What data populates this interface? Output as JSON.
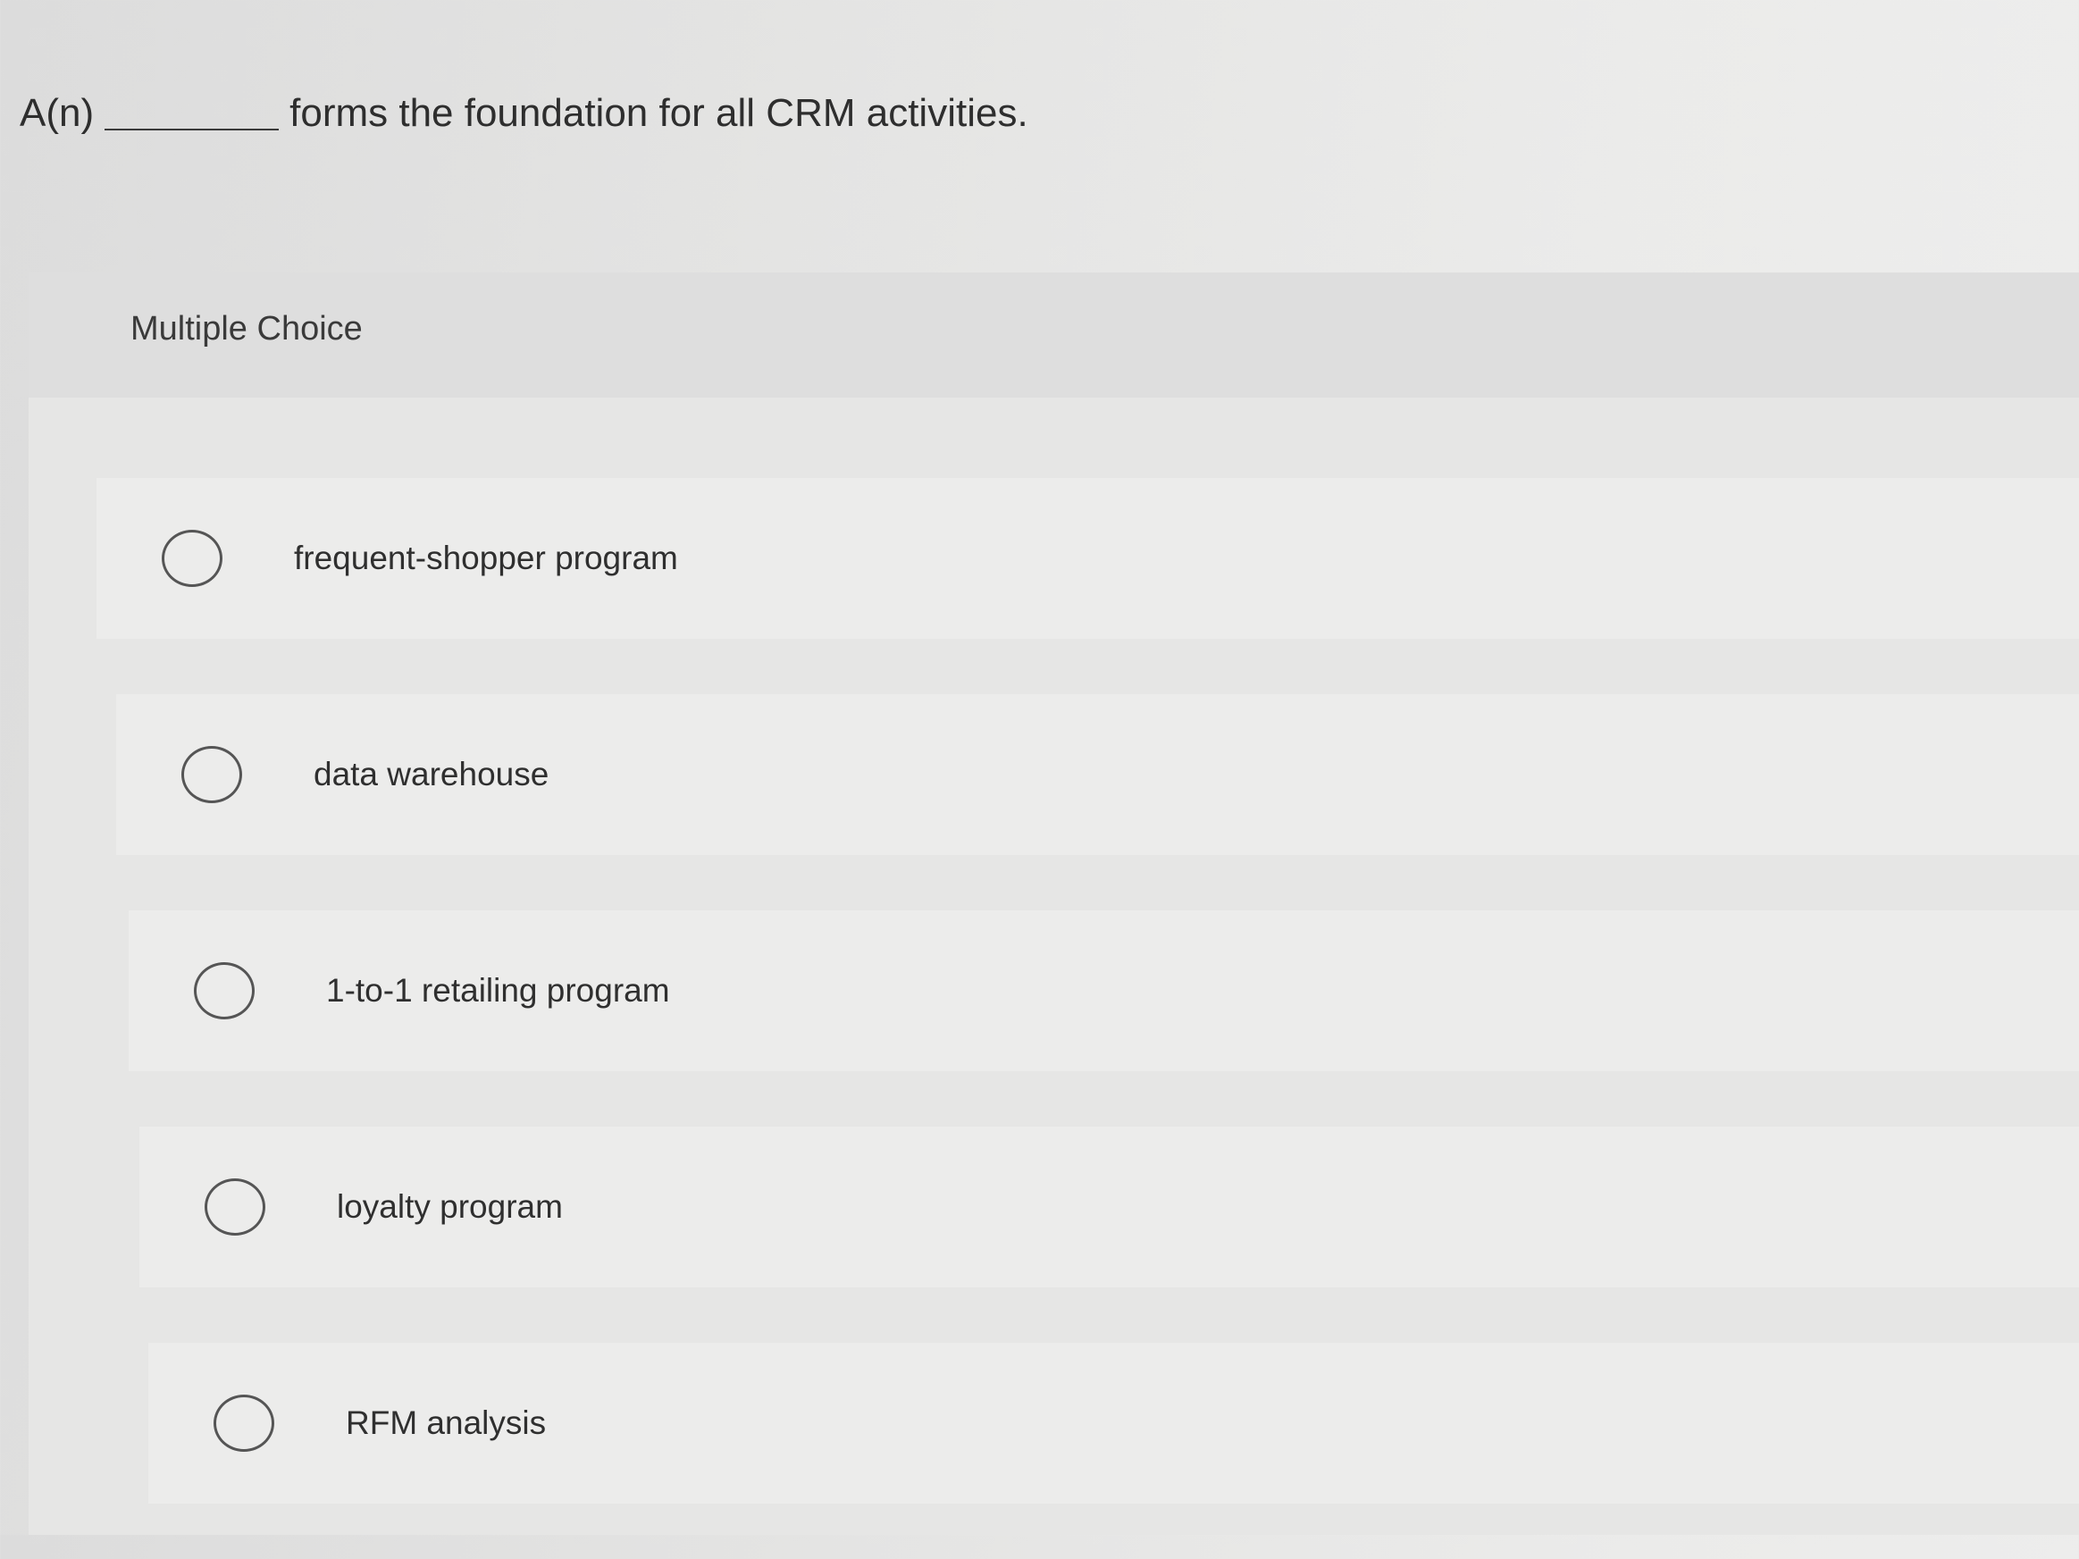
{
  "question": {
    "prefix": "A(n)",
    "suffix": "forms the foundation for all CRM activities."
  },
  "section": {
    "title": "Multiple Choice"
  },
  "options": [
    {
      "label": "frequent-shopper program",
      "selected": false
    },
    {
      "label": "data warehouse",
      "selected": false
    },
    {
      "label": "1-to-1 retailing program",
      "selected": false
    },
    {
      "label": "loyalty program",
      "selected": false
    },
    {
      "label": "RFM analysis",
      "selected": false
    }
  ]
}
